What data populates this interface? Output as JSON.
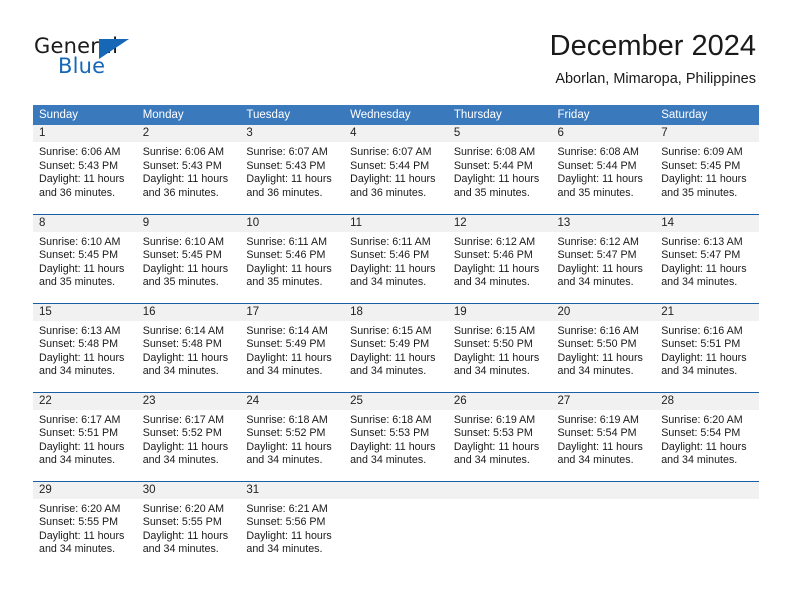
{
  "logo": {
    "word_top": "General",
    "word_bottom": "Blue",
    "accent_color": "#1667b5"
  },
  "header": {
    "title": "December 2024",
    "subtitle": "Aborlan, Mimaropa, Philippines"
  },
  "theme": {
    "header_bg": "#3b79bd",
    "row_divider": "#1a5fa3",
    "daynum_bg": "#f1f1f1",
    "text": "#1a1a1a"
  },
  "weekday_headers": [
    "Sunday",
    "Monday",
    "Tuesday",
    "Wednesday",
    "Thursday",
    "Friday",
    "Saturday"
  ],
  "labels": {
    "sunrise_prefix": "Sunrise:",
    "sunset_prefix": "Sunset:",
    "daylight_prefix": "Daylight:"
  },
  "weeks": [
    [
      {
        "day": "1",
        "sunrise": "Sunrise: 6:06 AM",
        "sunset": "Sunset: 5:43 PM",
        "daylight1": "Daylight: 11 hours",
        "daylight2": "and 36 minutes."
      },
      {
        "day": "2",
        "sunrise": "Sunrise: 6:06 AM",
        "sunset": "Sunset: 5:43 PM",
        "daylight1": "Daylight: 11 hours",
        "daylight2": "and 36 minutes."
      },
      {
        "day": "3",
        "sunrise": "Sunrise: 6:07 AM",
        "sunset": "Sunset: 5:43 PM",
        "daylight1": "Daylight: 11 hours",
        "daylight2": "and 36 minutes."
      },
      {
        "day": "4",
        "sunrise": "Sunrise: 6:07 AM",
        "sunset": "Sunset: 5:44 PM",
        "daylight1": "Daylight: 11 hours",
        "daylight2": "and 36 minutes."
      },
      {
        "day": "5",
        "sunrise": "Sunrise: 6:08 AM",
        "sunset": "Sunset: 5:44 PM",
        "daylight1": "Daylight: 11 hours",
        "daylight2": "and 35 minutes."
      },
      {
        "day": "6",
        "sunrise": "Sunrise: 6:08 AM",
        "sunset": "Sunset: 5:44 PM",
        "daylight1": "Daylight: 11 hours",
        "daylight2": "and 35 minutes."
      },
      {
        "day": "7",
        "sunrise": "Sunrise: 6:09 AM",
        "sunset": "Sunset: 5:45 PM",
        "daylight1": "Daylight: 11 hours",
        "daylight2": "and 35 minutes."
      }
    ],
    [
      {
        "day": "8",
        "sunrise": "Sunrise: 6:10 AM",
        "sunset": "Sunset: 5:45 PM",
        "daylight1": "Daylight: 11 hours",
        "daylight2": "and 35 minutes."
      },
      {
        "day": "9",
        "sunrise": "Sunrise: 6:10 AM",
        "sunset": "Sunset: 5:45 PM",
        "daylight1": "Daylight: 11 hours",
        "daylight2": "and 35 minutes."
      },
      {
        "day": "10",
        "sunrise": "Sunrise: 6:11 AM",
        "sunset": "Sunset: 5:46 PM",
        "daylight1": "Daylight: 11 hours",
        "daylight2": "and 35 minutes."
      },
      {
        "day": "11",
        "sunrise": "Sunrise: 6:11 AM",
        "sunset": "Sunset: 5:46 PM",
        "daylight1": "Daylight: 11 hours",
        "daylight2": "and 34 minutes."
      },
      {
        "day": "12",
        "sunrise": "Sunrise: 6:12 AM",
        "sunset": "Sunset: 5:46 PM",
        "daylight1": "Daylight: 11 hours",
        "daylight2": "and 34 minutes."
      },
      {
        "day": "13",
        "sunrise": "Sunrise: 6:12 AM",
        "sunset": "Sunset: 5:47 PM",
        "daylight1": "Daylight: 11 hours",
        "daylight2": "and 34 minutes."
      },
      {
        "day": "14",
        "sunrise": "Sunrise: 6:13 AM",
        "sunset": "Sunset: 5:47 PM",
        "daylight1": "Daylight: 11 hours",
        "daylight2": "and 34 minutes."
      }
    ],
    [
      {
        "day": "15",
        "sunrise": "Sunrise: 6:13 AM",
        "sunset": "Sunset: 5:48 PM",
        "daylight1": "Daylight: 11 hours",
        "daylight2": "and 34 minutes."
      },
      {
        "day": "16",
        "sunrise": "Sunrise: 6:14 AM",
        "sunset": "Sunset: 5:48 PM",
        "daylight1": "Daylight: 11 hours",
        "daylight2": "and 34 minutes."
      },
      {
        "day": "17",
        "sunrise": "Sunrise: 6:14 AM",
        "sunset": "Sunset: 5:49 PM",
        "daylight1": "Daylight: 11 hours",
        "daylight2": "and 34 minutes."
      },
      {
        "day": "18",
        "sunrise": "Sunrise: 6:15 AM",
        "sunset": "Sunset: 5:49 PM",
        "daylight1": "Daylight: 11 hours",
        "daylight2": "and 34 minutes."
      },
      {
        "day": "19",
        "sunrise": "Sunrise: 6:15 AM",
        "sunset": "Sunset: 5:50 PM",
        "daylight1": "Daylight: 11 hours",
        "daylight2": "and 34 minutes."
      },
      {
        "day": "20",
        "sunrise": "Sunrise: 6:16 AM",
        "sunset": "Sunset: 5:50 PM",
        "daylight1": "Daylight: 11 hours",
        "daylight2": "and 34 minutes."
      },
      {
        "day": "21",
        "sunrise": "Sunrise: 6:16 AM",
        "sunset": "Sunset: 5:51 PM",
        "daylight1": "Daylight: 11 hours",
        "daylight2": "and 34 minutes."
      }
    ],
    [
      {
        "day": "22",
        "sunrise": "Sunrise: 6:17 AM",
        "sunset": "Sunset: 5:51 PM",
        "daylight1": "Daylight: 11 hours",
        "daylight2": "and 34 minutes."
      },
      {
        "day": "23",
        "sunrise": "Sunrise: 6:17 AM",
        "sunset": "Sunset: 5:52 PM",
        "daylight1": "Daylight: 11 hours",
        "daylight2": "and 34 minutes."
      },
      {
        "day": "24",
        "sunrise": "Sunrise: 6:18 AM",
        "sunset": "Sunset: 5:52 PM",
        "daylight1": "Daylight: 11 hours",
        "daylight2": "and 34 minutes."
      },
      {
        "day": "25",
        "sunrise": "Sunrise: 6:18 AM",
        "sunset": "Sunset: 5:53 PM",
        "daylight1": "Daylight: 11 hours",
        "daylight2": "and 34 minutes."
      },
      {
        "day": "26",
        "sunrise": "Sunrise: 6:19 AM",
        "sunset": "Sunset: 5:53 PM",
        "daylight1": "Daylight: 11 hours",
        "daylight2": "and 34 minutes."
      },
      {
        "day": "27",
        "sunrise": "Sunrise: 6:19 AM",
        "sunset": "Sunset: 5:54 PM",
        "daylight1": "Daylight: 11 hours",
        "daylight2": "and 34 minutes."
      },
      {
        "day": "28",
        "sunrise": "Sunrise: 6:20 AM",
        "sunset": "Sunset: 5:54 PM",
        "daylight1": "Daylight: 11 hours",
        "daylight2": "and 34 minutes."
      }
    ],
    [
      {
        "day": "29",
        "sunrise": "Sunrise: 6:20 AM",
        "sunset": "Sunset: 5:55 PM",
        "daylight1": "Daylight: 11 hours",
        "daylight2": "and 34 minutes."
      },
      {
        "day": "30",
        "sunrise": "Sunrise: 6:20 AM",
        "sunset": "Sunset: 5:55 PM",
        "daylight1": "Daylight: 11 hours",
        "daylight2": "and 34 minutes."
      },
      {
        "day": "31",
        "sunrise": "Sunrise: 6:21 AM",
        "sunset": "Sunset: 5:56 PM",
        "daylight1": "Daylight: 11 hours",
        "daylight2": "and 34 minutes."
      },
      {
        "day": "",
        "sunrise": "",
        "sunset": "",
        "daylight1": "",
        "daylight2": ""
      },
      {
        "day": "",
        "sunrise": "",
        "sunset": "",
        "daylight1": "",
        "daylight2": ""
      },
      {
        "day": "",
        "sunrise": "",
        "sunset": "",
        "daylight1": "",
        "daylight2": ""
      },
      {
        "day": "",
        "sunrise": "",
        "sunset": "",
        "daylight1": "",
        "daylight2": ""
      }
    ]
  ]
}
